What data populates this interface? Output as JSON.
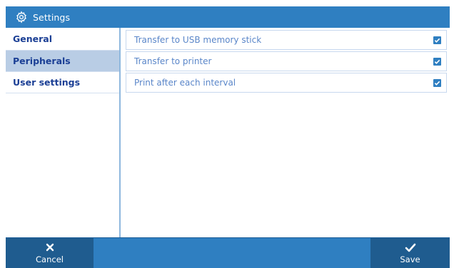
{
  "window": {
    "title": "Settings",
    "icon": "gear-icon"
  },
  "sidebar": {
    "items": [
      {
        "label": "General",
        "active": false
      },
      {
        "label": "Peripherals",
        "active": true
      },
      {
        "label": "User settings",
        "active": false
      }
    ]
  },
  "peripherals": {
    "options": [
      {
        "label": "Transfer to USB memory stick",
        "checked": true
      },
      {
        "label": "Transfer to printer",
        "checked": true
      },
      {
        "label": "Print after each interval",
        "checked": true
      }
    ]
  },
  "footer": {
    "cancel_label": "Cancel",
    "cancel_icon": "close-icon",
    "save_label": "Save",
    "save_icon": "checkmark-icon"
  },
  "colors": {
    "accent": "#2f7fc1",
    "button_dark": "#1f5c8f",
    "active_item": "#b9cde5",
    "sidebar_text": "#1b3f95",
    "option_text": "#5a86c9"
  }
}
